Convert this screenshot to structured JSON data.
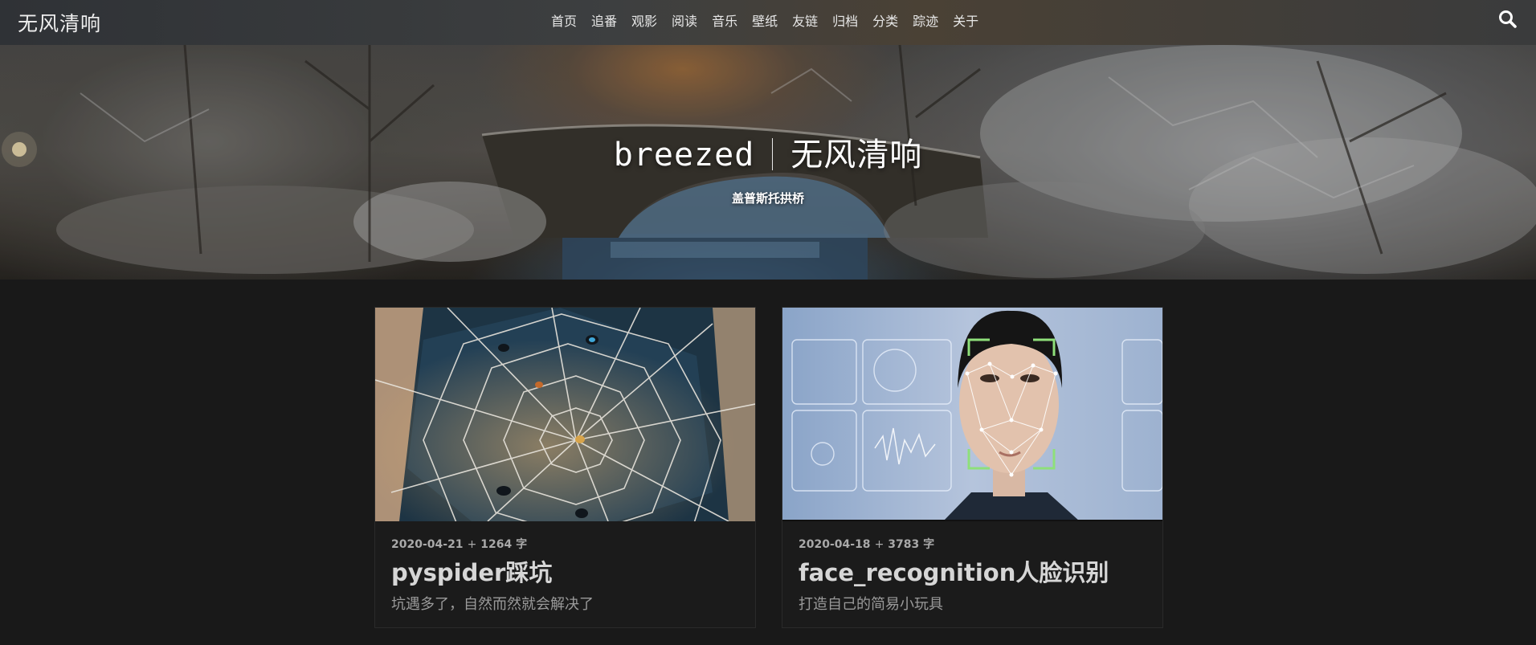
{
  "site": {
    "brand": "无风清响"
  },
  "nav": {
    "items": [
      "首页",
      "追番",
      "观影",
      "阅读",
      "音乐",
      "壁纸",
      "友链",
      "归档",
      "分类",
      "踪迹",
      "关于"
    ]
  },
  "hero": {
    "title_en": "breezed",
    "title_cn": "无风清响",
    "subtitle": "盖普斯托拱桥"
  },
  "icons": {
    "search": "search-icon"
  },
  "posts": [
    {
      "date": "2020-04-21",
      "sep": "+",
      "words": "1264 字",
      "title": "pyspider踩坑",
      "excerpt": "坑遇多了，自然而然就会解决了",
      "thumb": "spider-web-image"
    },
    {
      "date": "2020-04-18",
      "sep": "+",
      "words": "3783 字",
      "title": "face_recognition人脸识别",
      "excerpt": "打造自己的简易小玩具",
      "thumb": "face-recognition-image"
    }
  ],
  "colors": {
    "background": "#191919",
    "card": "#1b1b1b",
    "title_text": "#d6d6d6",
    "meta_text": "#a9a9a9",
    "face_box": "#8ee07a"
  }
}
